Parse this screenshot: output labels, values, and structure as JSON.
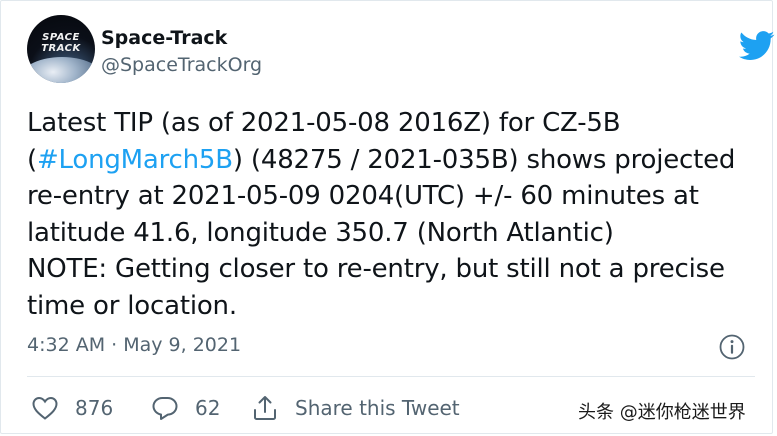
{
  "account": {
    "name": "Space-Track",
    "handle": "@SpaceTrackOrg",
    "avatar_lines": [
      "SPACE",
      "TRACK"
    ]
  },
  "brand_icon": "twitter-bird-icon",
  "colors": {
    "accent": "#1da1f2",
    "text": "#0f1419",
    "muted": "#536471",
    "divider": "#e1e8ed"
  },
  "tweet": {
    "line1": "Latest TIP (as of 2021-05-08 2016Z) for CZ-5B",
    "line2_open": "(",
    "line2_hashtag": "#LongMarch5B",
    "line2_rest": ") (48275 / 2021-035B) shows projected",
    "line3": "re-entry at 2021-05-09 0204(UTC) +/- 60 minutes at",
    "line4": "latitude 41.6, longitude 350.7 (North Atlantic)",
    "line5": "NOTE: Getting closer to re-entry, but still not a precise",
    "line6": "time or location."
  },
  "meta": {
    "timestamp": "4:32 AM · May 9, 2021",
    "info_icon": "info-icon"
  },
  "actions": {
    "like_count": "876",
    "reply_count": "62",
    "share_label": "Share this Tweet"
  },
  "watermark": "头条 @迷你枪迷世界"
}
